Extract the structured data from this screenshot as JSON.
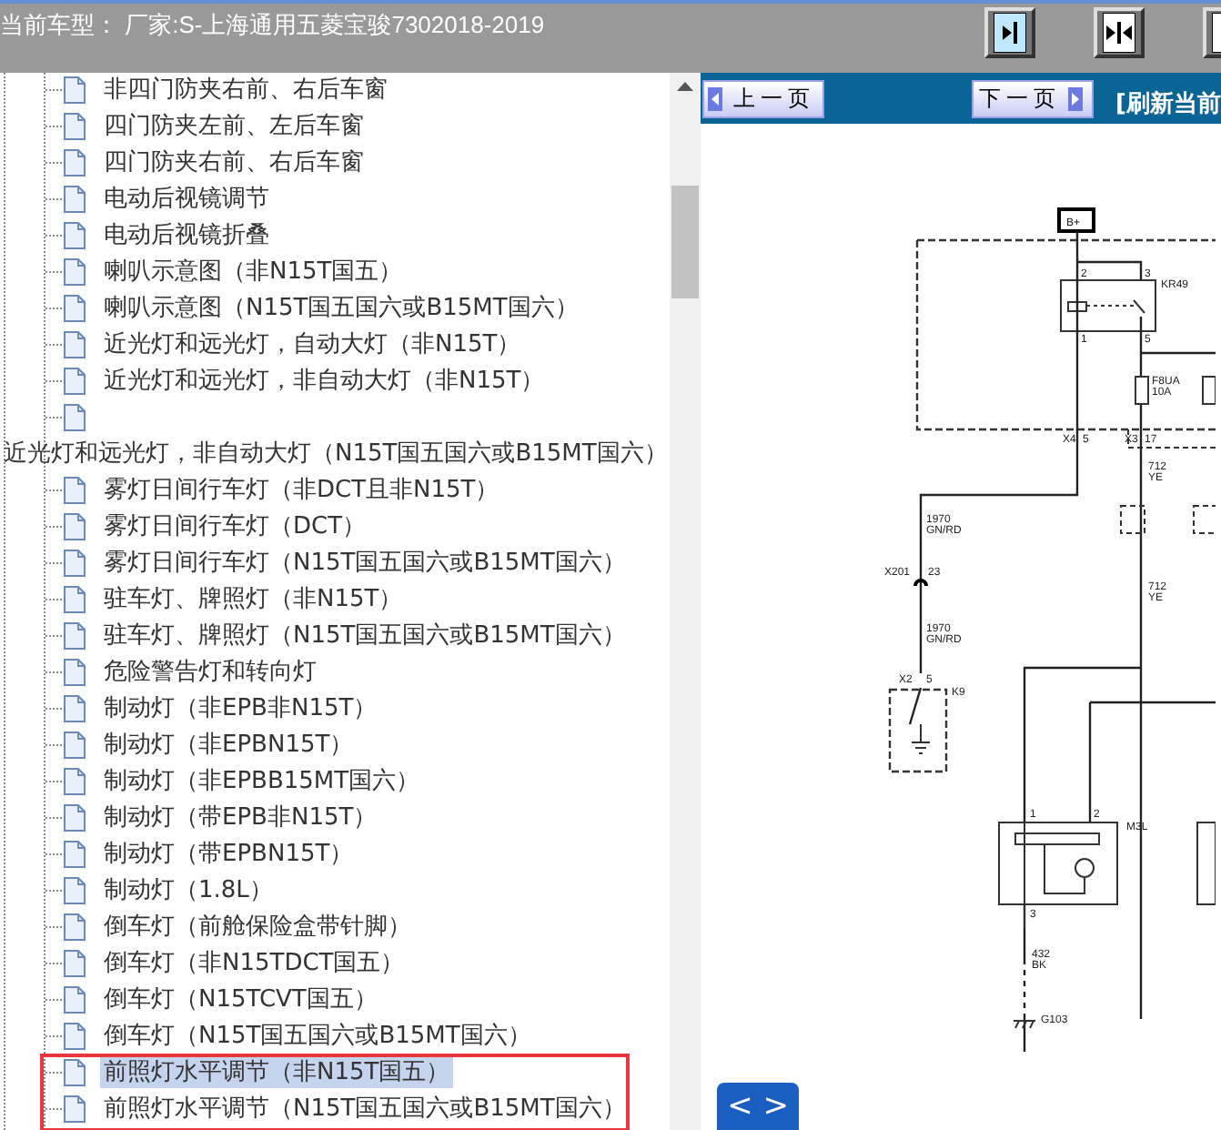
{
  "header": {
    "title": "当前车型：  厂家:S-上海通用五菱宝骏7302018-2019"
  },
  "tree": {
    "items": [
      {
        "label": "非四门防夹右前、右后车窗",
        "selected": false,
        "outlined": false
      },
      {
        "label": "四门防夹左前、左后车窗",
        "selected": false,
        "outlined": false
      },
      {
        "label": "四门防夹右前、右后车窗",
        "selected": false,
        "outlined": false
      },
      {
        "label": "电动后视镜调节",
        "selected": false,
        "outlined": false
      },
      {
        "label": "电动后视镜折叠",
        "selected": false,
        "outlined": false
      },
      {
        "label": "喇叭示意图（非N15T国五）",
        "selected": false,
        "outlined": false
      },
      {
        "label": "喇叭示意图（N15T国五国六或B15MT国六）",
        "selected": false,
        "outlined": false
      },
      {
        "label": "近光灯和远光灯，自动大灯（非N15T）",
        "selected": false,
        "outlined": false
      },
      {
        "label": "近光灯和远光灯，非自动大灯（非N15T）",
        "selected": false,
        "outlined": false
      },
      {
        "label": "近光灯和远光灯，非自动大灯（N15T国五国六或B15MT国六）",
        "selected": false,
        "outlined": false
      },
      {
        "label": "雾灯日间行车灯（非DCT且非N15T）",
        "selected": false,
        "outlined": false
      },
      {
        "label": "雾灯日间行车灯（DCT）",
        "selected": false,
        "outlined": false
      },
      {
        "label": "雾灯日间行车灯（N15T国五国六或B15MT国六）",
        "selected": false,
        "outlined": false
      },
      {
        "label": "驻车灯、牌照灯（非N15T）",
        "selected": false,
        "outlined": false
      },
      {
        "label": "驻车灯、牌照灯（N15T国五国六或B15MT国六）",
        "selected": false,
        "outlined": false
      },
      {
        "label": "危险警告灯和转向灯",
        "selected": false,
        "outlined": false
      },
      {
        "label": "制动灯（非EPB非N15T）",
        "selected": false,
        "outlined": false
      },
      {
        "label": "制动灯（非EPBN15T）",
        "selected": false,
        "outlined": false
      },
      {
        "label": "制动灯（非EPBB15MT国六）",
        "selected": false,
        "outlined": false
      },
      {
        "label": "制动灯（带EPB非N15T）",
        "selected": false,
        "outlined": false
      },
      {
        "label": "制动灯（带EPBN15T）",
        "selected": false,
        "outlined": false
      },
      {
        "label": "制动灯（1.8L）",
        "selected": false,
        "outlined": false
      },
      {
        "label": "倒车灯（前舱保险盒带针脚）",
        "selected": false,
        "outlined": false
      },
      {
        "label": "倒车灯（非N15TDCT国五）",
        "selected": false,
        "outlined": false
      },
      {
        "label": "倒车灯（N15TCVT国五）",
        "selected": false,
        "outlined": false
      },
      {
        "label": "倒车灯（N15T国五国六或B15MT国六）",
        "selected": false,
        "outlined": false
      },
      {
        "label": "前照灯水平调节（非N15T国五）",
        "selected": true,
        "outlined": true
      },
      {
        "label": "前照灯水平调节（N15T国五国六或B15MT国六）",
        "selected": false,
        "outlined": true
      }
    ]
  },
  "viewer": {
    "prev_button": "上一页",
    "next_button": "下一页",
    "refresh_link": "[刷新当前",
    "page_toggle": "< >",
    "diagram_labels": [
      "B+",
      "KR49",
      "2",
      "3",
      "1",
      "5",
      "F8UA",
      "10A",
      "X4",
      "5",
      "X3",
      "17",
      "712",
      "YE",
      "1970",
      "GN/RD",
      "X201",
      "23",
      "712",
      "YE",
      "1970",
      "GN/RD",
      "X2",
      "5",
      "K9",
      "1",
      "2",
      "M3L",
      "3",
      "432",
      "BK",
      "G103"
    ]
  }
}
